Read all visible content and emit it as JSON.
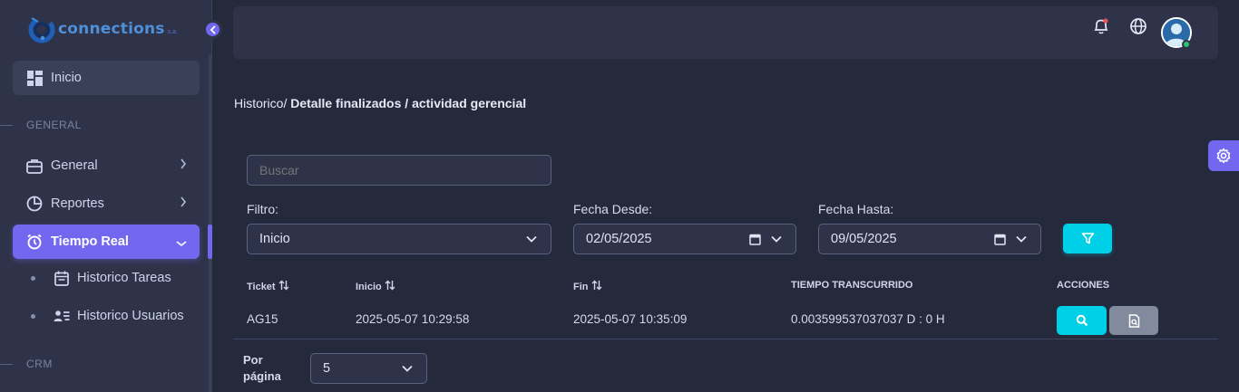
{
  "app": {
    "logo_text": "connections",
    "logo_sub": "s.a."
  },
  "sidebar": {
    "home_label": "Inicio",
    "section_general": "GENERAL",
    "section_crm": "CRM",
    "items": [
      {
        "label": "General",
        "icon": "briefcase-icon"
      },
      {
        "label": "Reportes",
        "icon": "chart-pie-icon"
      },
      {
        "label": "Tiempo Real",
        "icon": "alarm-clock-icon",
        "active": true
      }
    ],
    "subitems": [
      {
        "label": "Historico Tareas",
        "icon": "calendar-icon"
      },
      {
        "label": "Historico Usuarios",
        "icon": "users-list-icon"
      }
    ]
  },
  "topbar": {
    "icons": [
      "bell-icon",
      "globe-icon",
      "user-avatar"
    ]
  },
  "breadcrumb": {
    "prefix": "Historico/",
    "current": "Detalle finalizados / actividad gerencial"
  },
  "search": {
    "placeholder": "Buscar",
    "value": ""
  },
  "filters": {
    "filtro_label": "Filtro:",
    "filtro_value": "Inicio",
    "desde_label": "Fecha Desde:",
    "desde_value": "02/05/2025",
    "hasta_label": "Fecha Hasta:",
    "hasta_value": "09/05/2025"
  },
  "table": {
    "headers": [
      "Ticket",
      "Inicio",
      "Fin",
      "TIEMPO TRANSCURRIDO",
      "ACCIONES"
    ],
    "rows": [
      {
        "ticket": "AG15",
        "inicio": "2025-05-07 10:29:58",
        "fin": "2025-05-07 10:35:09",
        "tiempo": "0.003599537037037 D : 0 H"
      }
    ]
  },
  "pagination": {
    "label_line1": "Por",
    "label_line2": "página",
    "per_page": "5"
  },
  "colors": {
    "accent": "#7367f0",
    "info": "#00cfe8",
    "secondary": "#828b9d",
    "background": "#25293c",
    "surface": "#2f3349"
  }
}
